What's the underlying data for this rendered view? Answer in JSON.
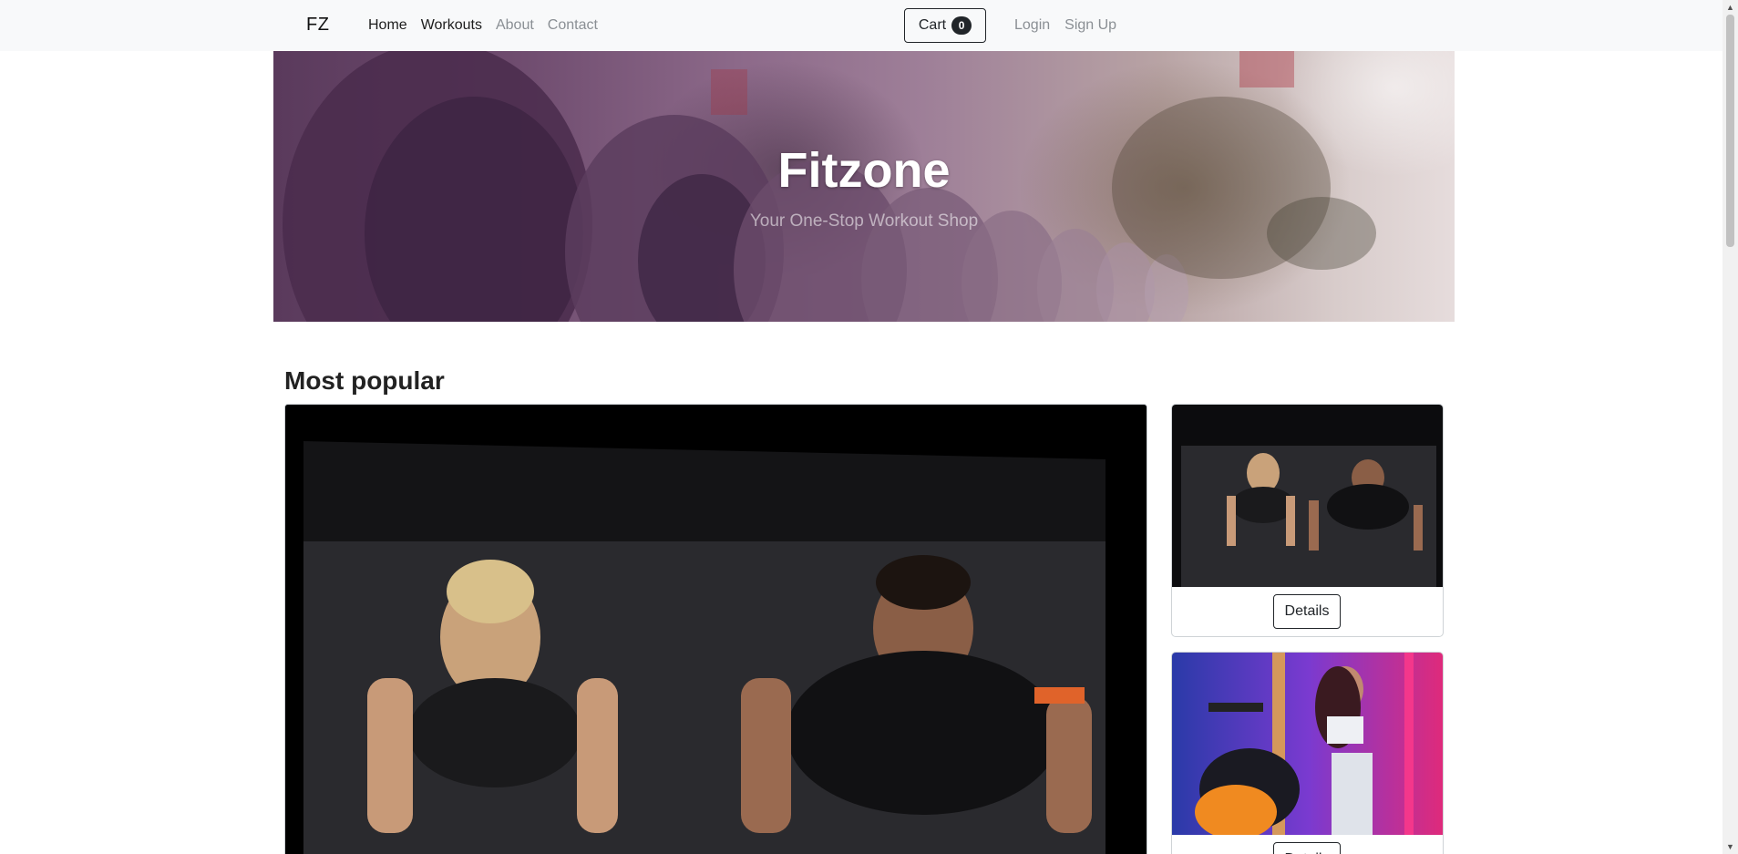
{
  "navbar": {
    "brand": "FZ",
    "links": [
      {
        "label": "Home",
        "active": true
      },
      {
        "label": "Workouts",
        "active": true
      },
      {
        "label": "About",
        "active": false
      },
      {
        "label": "Contact",
        "active": false
      }
    ],
    "cart": {
      "label": "Cart",
      "count": "0"
    },
    "auth": {
      "login": "Login",
      "signup": "Sign Up"
    }
  },
  "hero": {
    "title": "Fitzone",
    "subtitle": "Your One-Stop Workout Shop"
  },
  "main": {
    "section_title": "Most popular",
    "cards": [
      {
        "button_label": "Details"
      },
      {
        "button_label": "Details"
      }
    ]
  },
  "colors": {
    "navbar_bg": "#f8f9fa",
    "text_dark": "#212529",
    "text_muted": "#8a8f94",
    "hero_tint": "#7a5878"
  },
  "icons": {
    "scroll_up": "scroll-up-arrow-icon",
    "scroll_down": "scroll-down-arrow-icon"
  }
}
